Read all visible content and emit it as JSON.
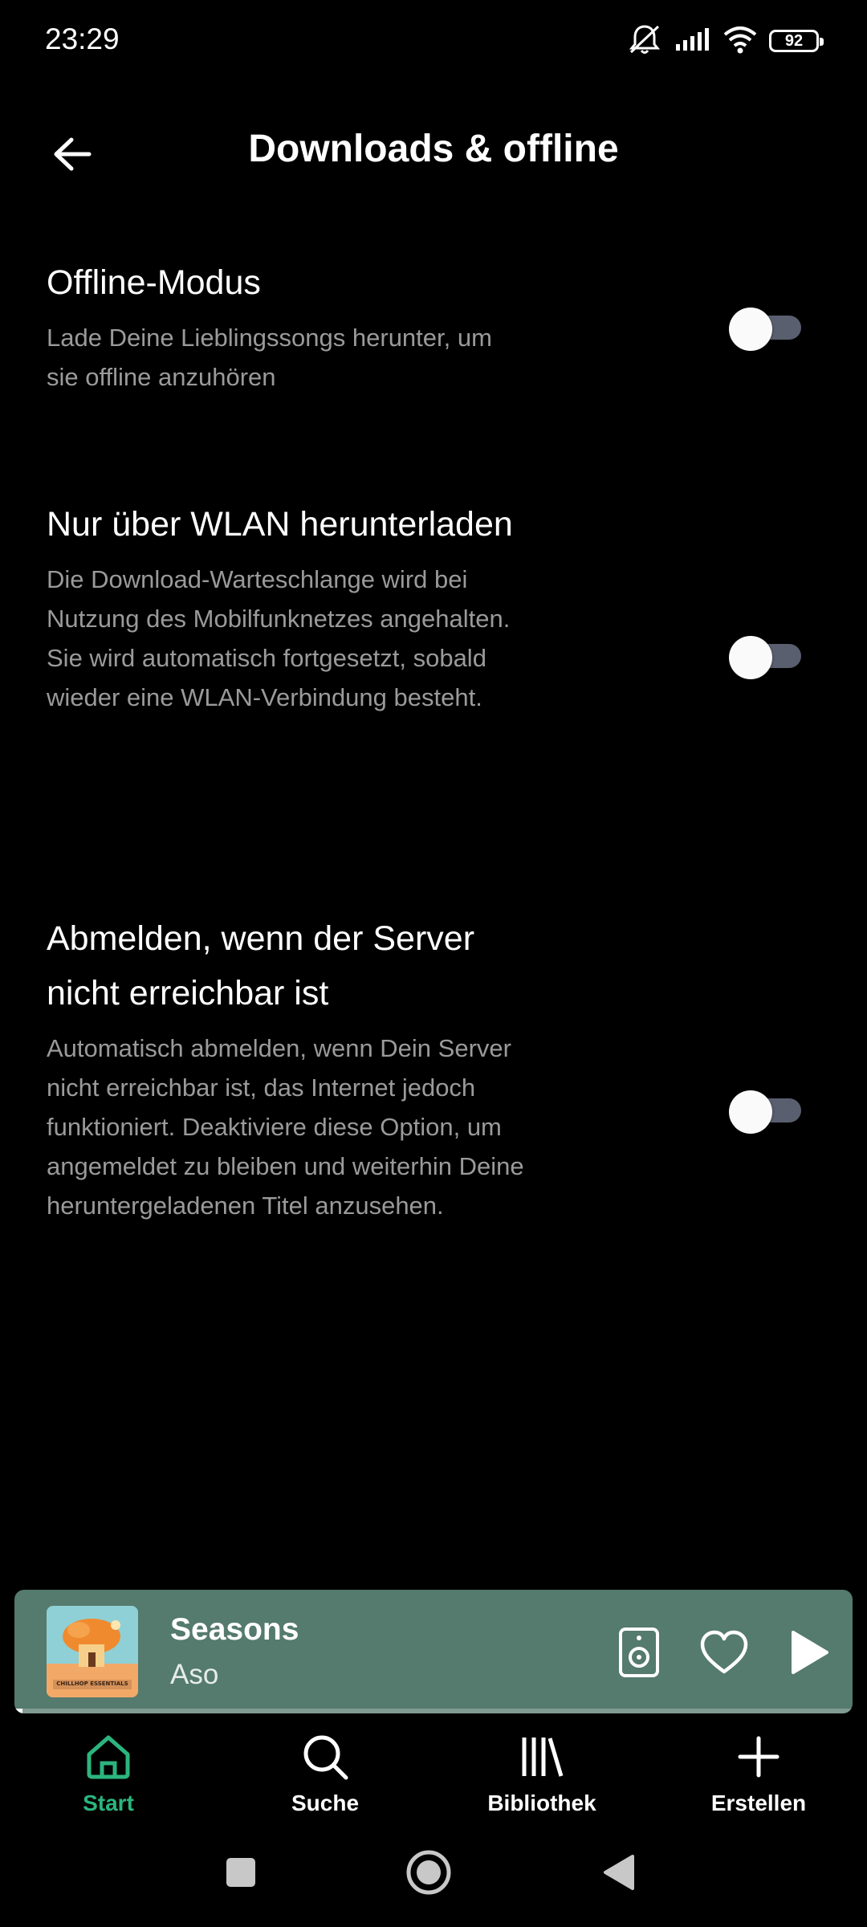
{
  "status_bar": {
    "time": "23:29",
    "battery": "92",
    "icons": [
      "bell-muted-icon",
      "signal-icon",
      "wifi-icon",
      "battery-icon"
    ]
  },
  "header": {
    "title": "Downloads & offline",
    "back_icon": "arrow-left-icon"
  },
  "settings": [
    {
      "title": "Offline-Modus",
      "description": "Lade Deine Lieblingssongs herunter, um sie offline anzuhören",
      "enabled": false
    },
    {
      "title": "Nur über WLAN herunterladen",
      "description": "Die Download-Warteschlange wird bei Nutzung des Mobilfunknetzes angehalten. Sie wird automatisch fortgesetzt, sobald wieder eine WLAN-Verbindung besteht.",
      "enabled": false
    },
    {
      "title": "Abmelden, wenn der Server nicht erreichbar ist",
      "description": "Automatisch abmelden, wenn Dein Server nicht erreichbar ist, das Internet jedoch funktioniert. Deaktiviere diese Option, um angemeldet zu bleiben und weiterhin Deine heruntergeladenen Titel anzusehen.",
      "enabled": false
    }
  ],
  "mini_player": {
    "title": "Seasons",
    "artist": "Aso",
    "album_art_text": "CHILLHOP ESSENTIALS",
    "progress": 0.01,
    "background": "#557a6e"
  },
  "bottom_nav": [
    {
      "label": "Start",
      "icon": "home-icon",
      "active": true
    },
    {
      "label": "Suche",
      "icon": "search-icon",
      "active": false
    },
    {
      "label": "Bibliothek",
      "icon": "library-icon",
      "active": false
    },
    {
      "label": "Erstellen",
      "icon": "plus-icon",
      "active": false
    }
  ],
  "colors": {
    "accent": "#2bb57e",
    "background": "#000000",
    "secondary_text": "#9a9a9a",
    "toggle_track": "#5a5f6f"
  }
}
